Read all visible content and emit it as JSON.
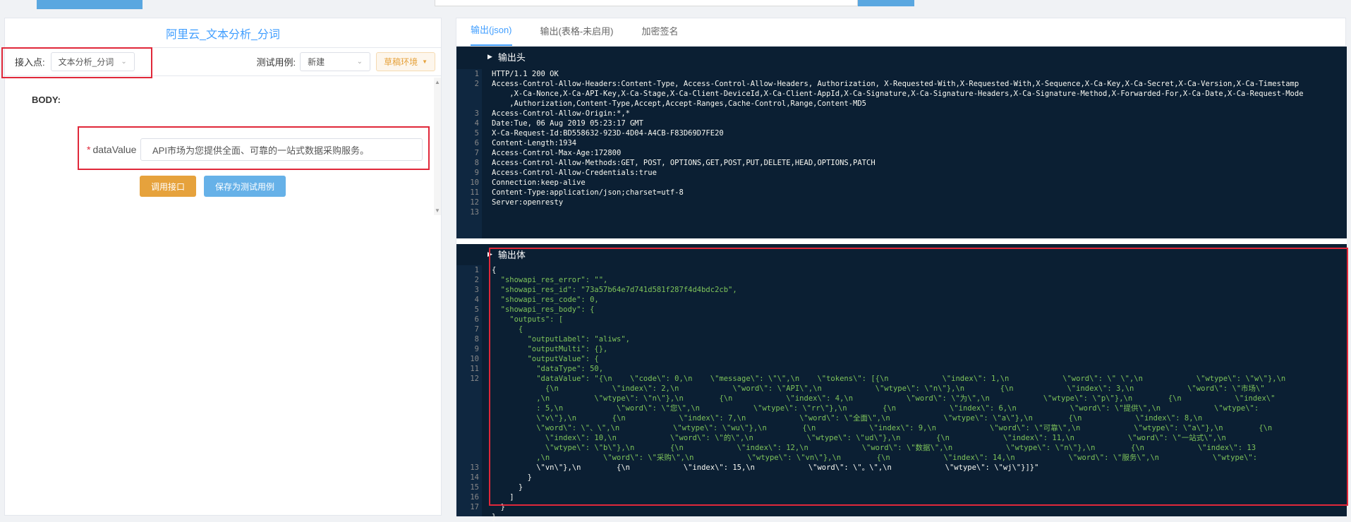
{
  "left": {
    "title": "阿里云_文本分析_分词",
    "endpoint_label": "接入点:",
    "endpoint_value": "文本分析_分词",
    "testcase_label": "测试用例:",
    "testcase_value": "新建",
    "env_button": "草稿环境",
    "body_label": "BODY:",
    "field_required": "*",
    "field_label": "dataValue",
    "field_value": "API市场为您提供全面、可靠的一站式数据采购服务。",
    "call_button": "调用接口",
    "save_button": "保存为测试用例"
  },
  "right": {
    "tabs": [
      "输出(json)",
      "输出(表格-未启用)",
      "加密签名"
    ],
    "header_section": "输出头",
    "body_section": "输出体",
    "header_lines": [
      "HTTP/1.1 200 OK",
      "Access-Control-Allow-Headers:Content-Type, Access-Control-Allow-Headers, Authorization, X-Requested-With,X-Requested-With,X-Sequence,X-Ca-Key,X-Ca-Secret,X-Ca-Version,X-Ca-Timestamp",
      "    ,X-Ca-Nonce,X-Ca-API-Key,X-Ca-Stage,X-Ca-Client-DeviceId,X-Ca-Client-AppId,X-Ca-Signature,X-Ca-Signature-Headers,X-Ca-Signature-Method,X-Forwarded-For,X-Ca-Date,X-Ca-Request-Mode",
      "    ,Authorization,Content-Type,Accept,Accept-Ranges,Cache-Control,Range,Content-MD5",
      "Access-Control-Allow-Origin:*,*",
      "Date:Tue, 06 Aug 2019 05:23:17 GMT",
      "X-Ca-Request-Id:BD558632-923D-4D04-A4CB-F83D69D7FE20",
      "Content-Length:1934",
      "Access-Control-Max-Age:172800",
      "Access-Control-Allow-Methods:GET, POST, OPTIONS,GET,POST,PUT,DELETE,HEAD,OPTIONS,PATCH",
      "Access-Control-Allow-Credentials:true",
      "Connection:keep-alive",
      "Content-Type:application/json;charset=utf-8",
      "Server:openresty",
      ""
    ],
    "header_gutter": [
      "1",
      "2",
      "",
      "",
      "3",
      "4",
      "5",
      "6",
      "7",
      "8",
      "9",
      "10",
      "11",
      "12",
      "13"
    ],
    "body_gutter": [
      "1",
      "2",
      "3",
      "4",
      "5",
      "6",
      "7",
      "8",
      "9",
      "10",
      "11",
      "12",
      "",
      "",
      "",
      "",
      "",
      "",
      "",
      "",
      "13",
      "14",
      "15",
      "16",
      "17"
    ],
    "body_lines": [
      "{",
      "  \"showapi_res_error\": \"\",",
      "  \"showapi_res_id\": \"73a57b64e7d741d581f287f4d4bdc2cb\",",
      "  \"showapi_res_code\": 0,",
      "  \"showapi_res_body\": {",
      "    \"outputs\": [",
      "      {",
      "        \"outputLabel\": \"aliws\",",
      "        \"outputMulti\": {},",
      "        \"outputValue\": {",
      "          \"dataType\": 50,",
      "          \"dataValue\": \"{\\n    \\\"code\\\": 0,\\n    \\\"message\\\": \\\"\\\",\\n    \\\"tokens\\\": [{\\n            \\\"index\\\": 1,\\n            \\\"word\\\": \\\" \\\",\\n            \\\"wtype\\\": \\\"w\\\"},\\n",
      "            {\\n            \\\"index\\\": 2,\\n            \\\"word\\\": \\\"API\\\",\\n            \\\"wtype\\\": \\\"n\\\"},\\n        {\\n            \\\"index\\\": 3,\\n            \\\"word\\\": \\\"市场\\\"",
      "          ,\\n          \\\"wtype\\\": \\\"n\\\"},\\n        {\\n            \\\"index\\\": 4,\\n            \\\"word\\\": \\\"为\\\",\\n            \\\"wtype\\\": \\\"p\\\"},\\n        {\\n            \\\"index\\\"",
      "          : 5,\\n            \\\"word\\\": \\\"您\\\",\\n            \\\"wtype\\\": \\\"rr\\\"},\\n        {\\n            \\\"index\\\": 6,\\n            \\\"word\\\": \\\"提供\\\",\\n            \\\"wtype\\\":",
      "          \\\"v\\\"},\\n        {\\n            \\\"index\\\": 7,\\n            \\\"word\\\": \\\"全面\\\",\\n            \\\"wtype\\\": \\\"a\\\"},\\n        {\\n            \\\"index\\\": 8,\\n",
      "          \\\"word\\\": \\\"、\\\",\\n            \\\"wtype\\\": \\\"wu\\\"},\\n        {\\n            \\\"index\\\": 9,\\n            \\\"word\\\": \\\"可靠\\\",\\n            \\\"wtype\\\": \\\"a\\\"},\\n        {\\n",
      "            \\\"index\\\": 10,\\n            \\\"word\\\": \\\"的\\\",\\n            \\\"wtype\\\": \\\"ud\\\"},\\n        {\\n            \\\"index\\\": 11,\\n            \\\"word\\\": \\\"一站式\\\",\\n",
      "            \\\"wtype\\\": \\\"b\\\"},\\n        {\\n            \\\"index\\\": 12,\\n            \\\"word\\\": \\\"数据\\\",\\n            \\\"wtype\\\": \\\"n\\\"},\\n        {\\n            \\\"index\\\": 13",
      "          ,\\n            \\\"word\\\": \\\"采购\\\",\\n            \\\"wtype\\\": \\\"vn\\\"},\\n        {\\n            \\\"index\\\": 14,\\n            \\\"word\\\": \\\"服务\\\",\\n            \\\"wtype\\\":",
      "          \\\"vn\\\"},\\n        {\\n            \\\"index\\\": 15,\\n            \\\"word\\\": \\\"。\\\",\\n            \\\"wtype\\\": \\\"wj\\\"}]}\"",
      "        }",
      "      }",
      "    ]",
      "  }",
      "}"
    ]
  }
}
